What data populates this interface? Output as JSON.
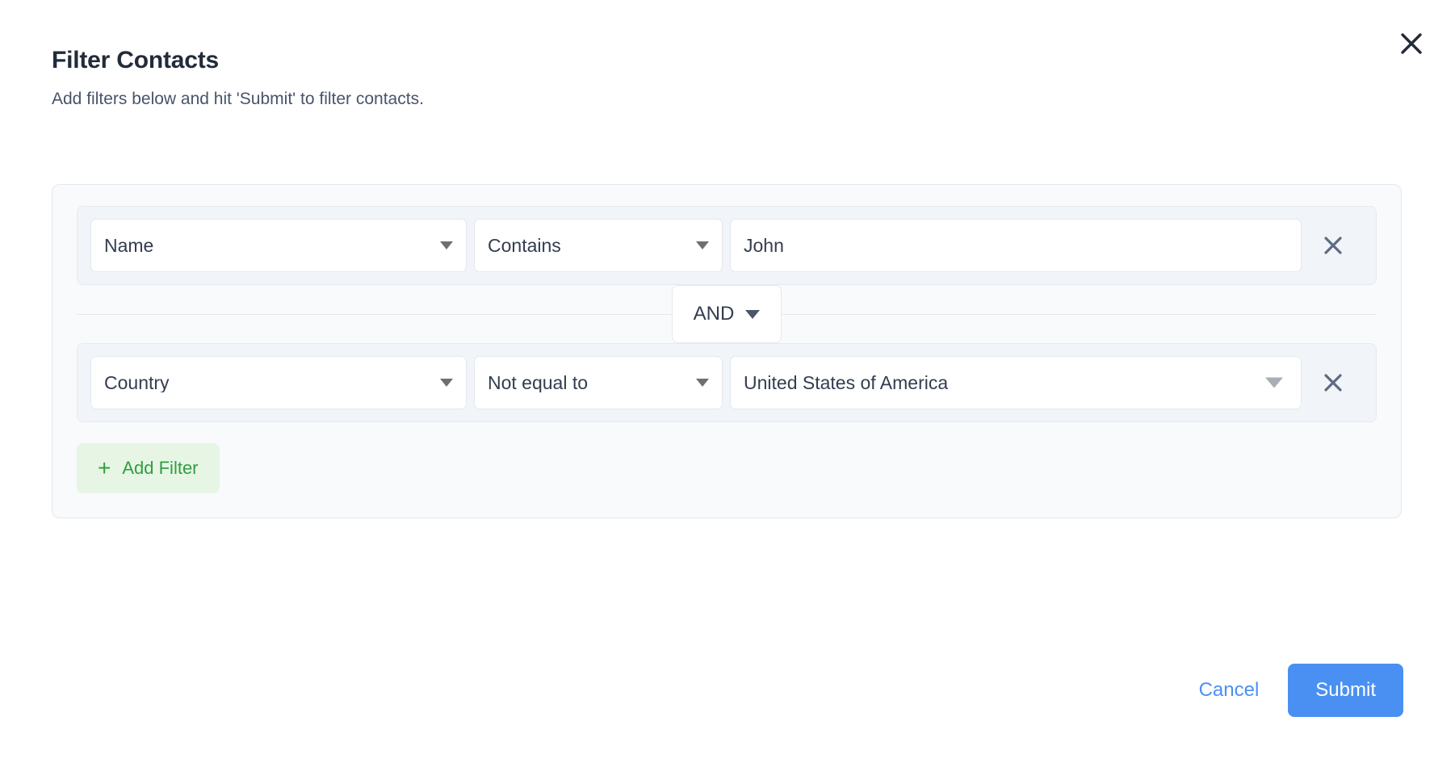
{
  "dialog": {
    "title": "Filter Contacts",
    "subtitle": "Add filters below and hit 'Submit' to filter contacts.",
    "close_icon": "close-icon"
  },
  "filters": {
    "rows": [
      {
        "field": "Name",
        "operator": "Contains",
        "value": "John",
        "value_kind": "text",
        "delete_icon": "close-icon"
      },
      {
        "field": "Country",
        "operator": "Not equal to",
        "value": "United States of America",
        "value_kind": "select",
        "delete_icon": "close-icon"
      }
    ],
    "connector": {
      "label": "AND",
      "caret_icon": "chevron-down-icon"
    },
    "add_filter": {
      "plus_icon": "+",
      "label": "Add Filter"
    }
  },
  "footer": {
    "cancel_label": "Cancel",
    "submit_label": "Submit"
  },
  "colors": {
    "accent_blue": "#4a90f2",
    "add_filter_green": "#2f9e41",
    "add_filter_bg": "#e6f5e4",
    "panel_bg": "#f8fafc",
    "row_bg": "#f1f4f8",
    "title_text": "#222b3a",
    "body_text": "#48546b",
    "delete_icon": "#5d6b85"
  }
}
